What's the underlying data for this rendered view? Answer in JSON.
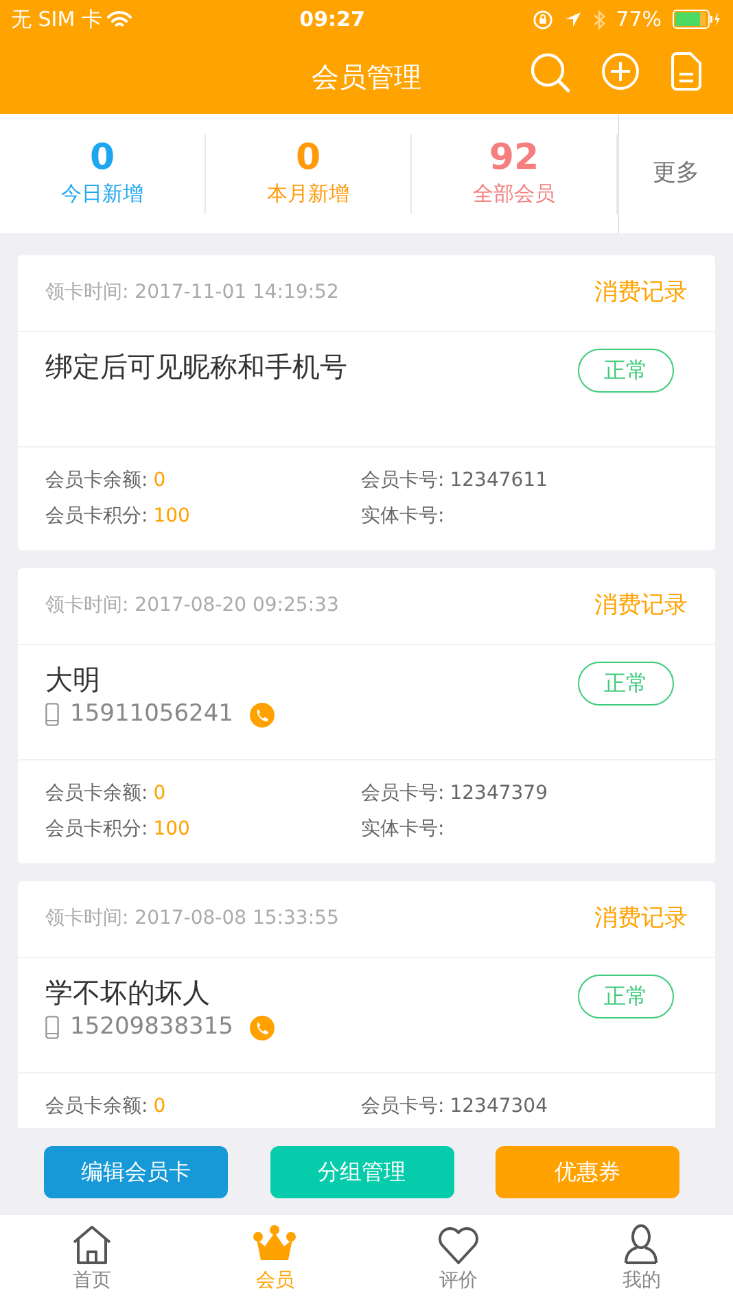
{
  "status_bar": {
    "carrier": "无 SIM 卡",
    "time": "09:27",
    "battery": "77%"
  },
  "header": {
    "title": "会员管理"
  },
  "stats": [
    {
      "value": "0",
      "label": "今日新增",
      "color": "#1ea7f0"
    },
    {
      "value": "0",
      "label": "本月新增",
      "color": "#ff9a0a"
    },
    {
      "value": "92",
      "label": "全部会员",
      "color": "#f57f7f"
    }
  ],
  "more": "更多",
  "members": [
    {
      "time": "领卡时间: 2017-11-01 14:19:52",
      "records": "消费记录",
      "name": "绑定后可见昵称和手机号",
      "status": "正常",
      "fields": [
        {
          "label": "会员卡余额:",
          "value": "0",
          "highlight": true
        },
        {
          "label": "会员卡号:",
          "value": "12347611",
          "highlight": false
        },
        {
          "label": "会员卡积分:",
          "value": "100",
          "highlight": true
        },
        {
          "label": "实体卡号:"
        }
      ]
    },
    {
      "time": "领卡时间: 2017-08-20 09:25:33",
      "records": "消费记录",
      "name": "大明",
      "phone": "15911056241",
      "status": "正常",
      "fields": [
        {
          "label": "会员卡余额:",
          "value": "0",
          "highlight": true
        },
        {
          "label": "会员卡号:",
          "value": "12347379",
          "highlight": false
        },
        {
          "label": "会员卡积分:",
          "value": "100",
          "highlight": true
        },
        {
          "label": "实体卡号:"
        }
      ]
    },
    {
      "time": "领卡时间: 2017-08-08 15:33:55",
      "records": "消费记录",
      "name": "学不坏的坏人",
      "phone": "15209838315",
      "status": "正常",
      "fields": [
        {
          "label": "会员卡余额:",
          "value": "0",
          "highlight": true
        },
        {
          "label": "会员卡号:",
          "value": "12347304",
          "highlight": false
        }
      ]
    }
  ],
  "actions": [
    {
      "label": "编辑会员卡",
      "color": "#1699d6"
    },
    {
      "label": "分组管理",
      "color": "#06ccab"
    },
    {
      "label": "优惠券",
      "color": "#ffa200"
    }
  ],
  "tabs": [
    {
      "label": "首页",
      "kind": "home",
      "selected": false
    },
    {
      "label": "会员",
      "kind": "crown",
      "selected": true
    },
    {
      "label": "评价",
      "kind": "heart",
      "selected": false
    },
    {
      "label": "我的",
      "kind": "person",
      "selected": false
    }
  ]
}
